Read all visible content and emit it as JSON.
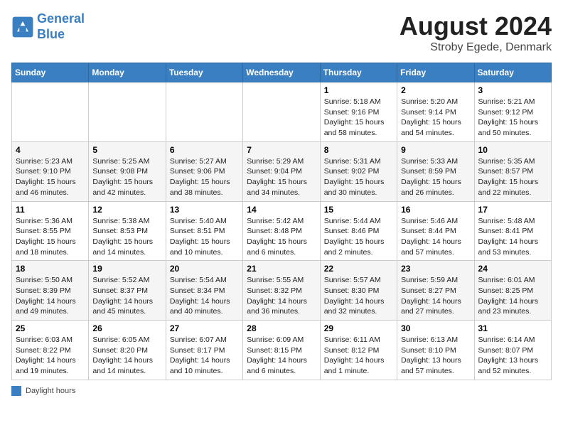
{
  "header": {
    "logo_line1": "General",
    "logo_line2": "Blue",
    "month_title": "August 2024",
    "location": "Stroby Egede, Denmark"
  },
  "weekdays": [
    "Sunday",
    "Monday",
    "Tuesday",
    "Wednesday",
    "Thursday",
    "Friday",
    "Saturday"
  ],
  "legend": {
    "label": "Daylight hours"
  },
  "weeks": [
    [
      {
        "day": "",
        "sunrise": "",
        "sunset": "",
        "daylight": ""
      },
      {
        "day": "",
        "sunrise": "",
        "sunset": "",
        "daylight": ""
      },
      {
        "day": "",
        "sunrise": "",
        "sunset": "",
        "daylight": ""
      },
      {
        "day": "",
        "sunrise": "",
        "sunset": "",
        "daylight": ""
      },
      {
        "day": "1",
        "sunrise": "Sunrise: 5:18 AM",
        "sunset": "Sunset: 9:16 PM",
        "daylight": "Daylight: 15 hours and 58 minutes."
      },
      {
        "day": "2",
        "sunrise": "Sunrise: 5:20 AM",
        "sunset": "Sunset: 9:14 PM",
        "daylight": "Daylight: 15 hours and 54 minutes."
      },
      {
        "day": "3",
        "sunrise": "Sunrise: 5:21 AM",
        "sunset": "Sunset: 9:12 PM",
        "daylight": "Daylight: 15 hours and 50 minutes."
      }
    ],
    [
      {
        "day": "4",
        "sunrise": "Sunrise: 5:23 AM",
        "sunset": "Sunset: 9:10 PM",
        "daylight": "Daylight: 15 hours and 46 minutes."
      },
      {
        "day": "5",
        "sunrise": "Sunrise: 5:25 AM",
        "sunset": "Sunset: 9:08 PM",
        "daylight": "Daylight: 15 hours and 42 minutes."
      },
      {
        "day": "6",
        "sunrise": "Sunrise: 5:27 AM",
        "sunset": "Sunset: 9:06 PM",
        "daylight": "Daylight: 15 hours and 38 minutes."
      },
      {
        "day": "7",
        "sunrise": "Sunrise: 5:29 AM",
        "sunset": "Sunset: 9:04 PM",
        "daylight": "Daylight: 15 hours and 34 minutes."
      },
      {
        "day": "8",
        "sunrise": "Sunrise: 5:31 AM",
        "sunset": "Sunset: 9:02 PM",
        "daylight": "Daylight: 15 hours and 30 minutes."
      },
      {
        "day": "9",
        "sunrise": "Sunrise: 5:33 AM",
        "sunset": "Sunset: 8:59 PM",
        "daylight": "Daylight: 15 hours and 26 minutes."
      },
      {
        "day": "10",
        "sunrise": "Sunrise: 5:35 AM",
        "sunset": "Sunset: 8:57 PM",
        "daylight": "Daylight: 15 hours and 22 minutes."
      }
    ],
    [
      {
        "day": "11",
        "sunrise": "Sunrise: 5:36 AM",
        "sunset": "Sunset: 8:55 PM",
        "daylight": "Daylight: 15 hours and 18 minutes."
      },
      {
        "day": "12",
        "sunrise": "Sunrise: 5:38 AM",
        "sunset": "Sunset: 8:53 PM",
        "daylight": "Daylight: 15 hours and 14 minutes."
      },
      {
        "day": "13",
        "sunrise": "Sunrise: 5:40 AM",
        "sunset": "Sunset: 8:51 PM",
        "daylight": "Daylight: 15 hours and 10 minutes."
      },
      {
        "day": "14",
        "sunrise": "Sunrise: 5:42 AM",
        "sunset": "Sunset: 8:48 PM",
        "daylight": "Daylight: 15 hours and 6 minutes."
      },
      {
        "day": "15",
        "sunrise": "Sunrise: 5:44 AM",
        "sunset": "Sunset: 8:46 PM",
        "daylight": "Daylight: 15 hours and 2 minutes."
      },
      {
        "day": "16",
        "sunrise": "Sunrise: 5:46 AM",
        "sunset": "Sunset: 8:44 PM",
        "daylight": "Daylight: 14 hours and 57 minutes."
      },
      {
        "day": "17",
        "sunrise": "Sunrise: 5:48 AM",
        "sunset": "Sunset: 8:41 PM",
        "daylight": "Daylight: 14 hours and 53 minutes."
      }
    ],
    [
      {
        "day": "18",
        "sunrise": "Sunrise: 5:50 AM",
        "sunset": "Sunset: 8:39 PM",
        "daylight": "Daylight: 14 hours and 49 minutes."
      },
      {
        "day": "19",
        "sunrise": "Sunrise: 5:52 AM",
        "sunset": "Sunset: 8:37 PM",
        "daylight": "Daylight: 14 hours and 45 minutes."
      },
      {
        "day": "20",
        "sunrise": "Sunrise: 5:54 AM",
        "sunset": "Sunset: 8:34 PM",
        "daylight": "Daylight: 14 hours and 40 minutes."
      },
      {
        "day": "21",
        "sunrise": "Sunrise: 5:55 AM",
        "sunset": "Sunset: 8:32 PM",
        "daylight": "Daylight: 14 hours and 36 minutes."
      },
      {
        "day": "22",
        "sunrise": "Sunrise: 5:57 AM",
        "sunset": "Sunset: 8:30 PM",
        "daylight": "Daylight: 14 hours and 32 minutes."
      },
      {
        "day": "23",
        "sunrise": "Sunrise: 5:59 AM",
        "sunset": "Sunset: 8:27 PM",
        "daylight": "Daylight: 14 hours and 27 minutes."
      },
      {
        "day": "24",
        "sunrise": "Sunrise: 6:01 AM",
        "sunset": "Sunset: 8:25 PM",
        "daylight": "Daylight: 14 hours and 23 minutes."
      }
    ],
    [
      {
        "day": "25",
        "sunrise": "Sunrise: 6:03 AM",
        "sunset": "Sunset: 8:22 PM",
        "daylight": "Daylight: 14 hours and 19 minutes."
      },
      {
        "day": "26",
        "sunrise": "Sunrise: 6:05 AM",
        "sunset": "Sunset: 8:20 PM",
        "daylight": "Daylight: 14 hours and 14 minutes."
      },
      {
        "day": "27",
        "sunrise": "Sunrise: 6:07 AM",
        "sunset": "Sunset: 8:17 PM",
        "daylight": "Daylight: 14 hours and 10 minutes."
      },
      {
        "day": "28",
        "sunrise": "Sunrise: 6:09 AM",
        "sunset": "Sunset: 8:15 PM",
        "daylight": "Daylight: 14 hours and 6 minutes."
      },
      {
        "day": "29",
        "sunrise": "Sunrise: 6:11 AM",
        "sunset": "Sunset: 8:12 PM",
        "daylight": "Daylight: 14 hours and 1 minute."
      },
      {
        "day": "30",
        "sunrise": "Sunrise: 6:13 AM",
        "sunset": "Sunset: 8:10 PM",
        "daylight": "Daylight: 13 hours and 57 minutes."
      },
      {
        "day": "31",
        "sunrise": "Sunrise: 6:14 AM",
        "sunset": "Sunset: 8:07 PM",
        "daylight": "Daylight: 13 hours and 52 minutes."
      }
    ]
  ]
}
